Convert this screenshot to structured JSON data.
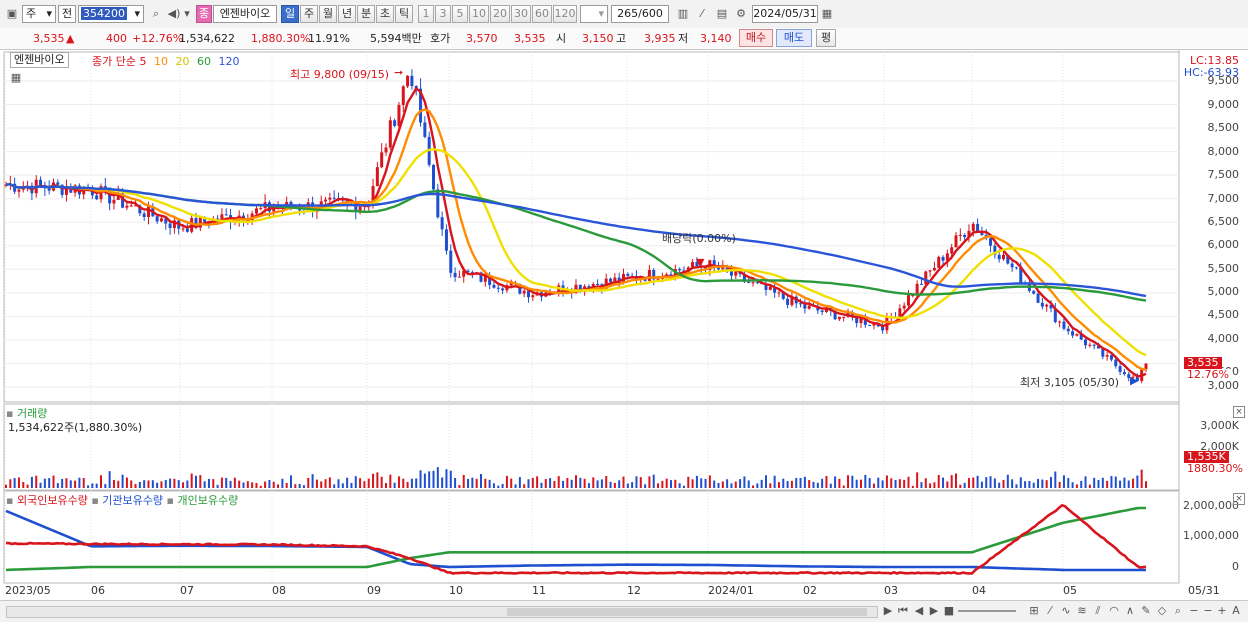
{
  "toolbar": {
    "market": "주",
    "market_prefix": "전",
    "code": "354200",
    "stock_badge": "종",
    "stock_name": "엔젠바이오",
    "periods": [
      "일",
      "주",
      "월",
      "년",
      "분",
      "초",
      "틱"
    ],
    "minute_steps": [
      "1",
      "3",
      "5",
      "10",
      "20",
      "30",
      "60",
      "120"
    ],
    "count_value": "265",
    "count_max": "/600",
    "date": "2024/05/31"
  },
  "quote": {
    "price": "3,535",
    "arrow": "▲",
    "change": "400",
    "change_pct": "+12.76%",
    "volume": "1,534,622",
    "volume_ratio": "1,880.30%",
    "turnover": "11.91%",
    "amount": "5,594백만",
    "ask_label": "호가",
    "ask": "3,570",
    "bid": "3,535",
    "open_label": "시",
    "open": "3,150",
    "high_label": "고",
    "high": "3,935",
    "low_label": "저",
    "low": "3,140",
    "buy_label": "매수",
    "sell_label": "매도",
    "avg_label": "평"
  },
  "price_panel": {
    "name_tab": "엔젠바이오",
    "ma_legend": {
      "prefix": "종가 단순",
      "periods": [
        "5",
        "10",
        "20",
        "60",
        "120"
      ]
    },
    "lc": "LC:13.85",
    "hc": "HC:-63.93",
    "high_note": "최고 9,800 (09/15)",
    "low_note": "최저 3,105 (05/30)",
    "dividend_note": "배당락(0.00%)",
    "price_tag": "3,535",
    "pct_tag": "12.76%",
    "y_ticks": [
      "9,500",
      "9,000",
      "8,500",
      "8,000",
      "7,500",
      "7,000",
      "6,500",
      "6,000",
      "5,500",
      "5,000",
      "4,500",
      "4,000",
      "3,500",
      "3,000"
    ]
  },
  "volume_panel": {
    "title": "거래량",
    "value": "1,534,622주(1,880.30%)",
    "y_ticks": [
      "3,000K",
      "2,000K"
    ],
    "tag": "1,535K",
    "tag_pct": "1880.30%"
  },
  "holdings_panel": {
    "legend": [
      "외국인보유수량",
      "기관보유수량",
      "개인보유수량"
    ],
    "y_ticks": [
      "2,000,000",
      "1,000,000",
      "0"
    ]
  },
  "x_ticks": [
    "2023/05",
    "06",
    "07",
    "08",
    "09",
    "10",
    "11",
    "12",
    "2024/01",
    "02",
    "03",
    "04",
    "05"
  ],
  "last_date": "05/31",
  "colors": {
    "up": "#d8141c",
    "down": "#1e4fd0",
    "ma5": "#d8141c",
    "ma10": "#ff8c00",
    "ma20": "#f0e000",
    "ma60": "#2a9a3a",
    "ma120": "#2a55d8"
  },
  "chart_data": {
    "type": "line",
    "x": [
      "2023/05",
      "06",
      "07",
      "08",
      "09",
      "09/15",
      "10",
      "11",
      "12",
      "2024/01",
      "02",
      "03",
      "04",
      "05",
      "05/30",
      "05/31"
    ],
    "series": [
      {
        "name": "종가",
        "values": [
          7300,
          7200,
          6400,
          6800,
          6900,
          9800,
          5500,
          5000,
          5300,
          5600,
          4700,
          4300,
          6500,
          4300,
          3105,
          3535
        ]
      },
      {
        "name": "외국인보유수량",
        "values": [
          1900000,
          700000,
          720000,
          710000,
          680000,
          100000,
          0,
          50000,
          80000,
          70000,
          20000,
          0,
          0,
          -100000,
          -100000,
          -100000
        ]
      },
      {
        "name": "기관보유수량",
        "values": [
          800000,
          780000,
          770000,
          760000,
          700000,
          300000,
          -200000,
          -200000,
          -200000,
          -200000,
          -200000,
          -200000,
          -200000,
          2100000,
          0,
          0
        ]
      },
      {
        "name": "개인보유수량",
        "values": [
          -100000,
          0,
          0,
          0,
          0,
          300000,
          500000,
          500000,
          500000,
          500000,
          500000,
          500000,
          500000,
          1500000,
          2000000,
          2000000
        ]
      }
    ],
    "volume_last": 1534622
  }
}
